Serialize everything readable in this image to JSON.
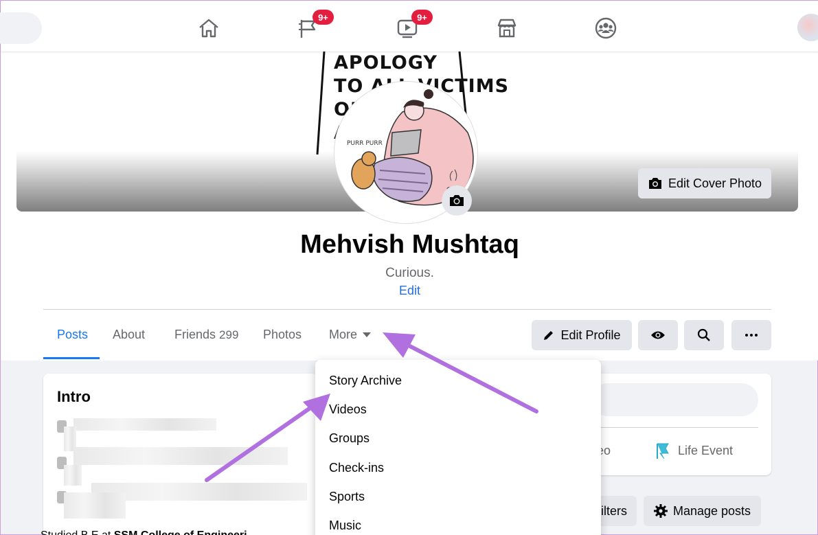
{
  "nav": {
    "badges": {
      "pages": "9+",
      "watch": "9+"
    }
  },
  "cover": {
    "text_lines": [
      "APOLOGY",
      "TO ALL VICTIMS",
      "OF M     AL",
      "AL"
    ],
    "edit_cover_label": "Edit Cover Photo"
  },
  "avatar": {
    "purr": "PURR PURR"
  },
  "profile": {
    "name": "Mehvish Mushtaq",
    "bio": "Curious.",
    "bio_edit": "Edit"
  },
  "tabs": {
    "posts": "Posts",
    "about": "About",
    "friends": "Friends",
    "friends_count": "299",
    "photos": "Photos",
    "more": "More"
  },
  "header_buttons": {
    "edit_profile": "Edit Profile"
  },
  "more_menu": {
    "items": [
      "Story Archive",
      "Videos",
      "Groups",
      "Check-ins",
      "Sports",
      "Music"
    ]
  },
  "intro": {
    "title": "Intro",
    "studied_prefix": "Studied B.E at",
    "studied_school": "SSM College of Engineeri..."
  },
  "composer": {
    "video_partial": "eo",
    "life_event": "Life Event"
  },
  "posts_toolbar": {
    "filters_partial": "ilters",
    "manage_posts": "Manage posts"
  },
  "colors": {
    "accent": "#1877f2",
    "badge": "#e41e3f",
    "annotation_arrow": "#b070e0"
  }
}
